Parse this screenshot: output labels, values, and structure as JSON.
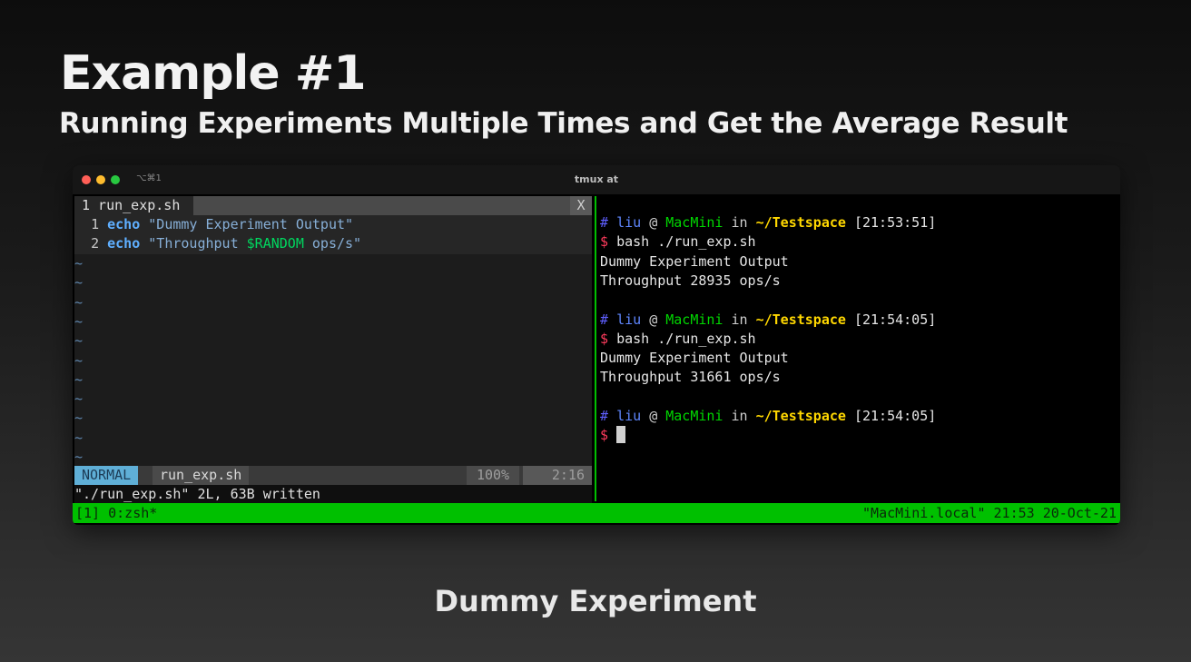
{
  "slide": {
    "title": "Example #1",
    "subtitle": "Running Experiments Multiple Times and Get the Average Result",
    "caption": "Dummy Experiment"
  },
  "window": {
    "shortcut": "⌥⌘1",
    "title": "tmux at",
    "colors": {
      "close": "#ff5f57",
      "minimize": "#febc2e",
      "zoom": "#28c840"
    }
  },
  "vim": {
    "tab_label": "1 run_exp.sh",
    "tab_close": "X",
    "lines": [
      {
        "num": "1",
        "keyword": "echo",
        "string": "\"Dummy Experiment Output\""
      },
      {
        "num": "2",
        "keyword": "echo",
        "string_before": "\"Throughput ",
        "variable": "$RANDOM",
        "string_after": " ops/s\""
      }
    ],
    "tilde": "~",
    "status": {
      "mode": "NORMAL",
      "file": "run_exp.sh",
      "percent": "100%",
      "position": "2:16"
    },
    "cmdline": "\"./run_exp.sh\" 2L, 63B written"
  },
  "shell": {
    "prompts": [
      {
        "hash": "#",
        "user": "liu",
        "at": "@",
        "host": "MacMini",
        "in": "in",
        "path": "~/Testspace",
        "time": "[21:53:51]"
      },
      {
        "hash": "#",
        "user": "liu",
        "at": "@",
        "host": "MacMini",
        "in": "in",
        "path": "~/Testspace",
        "time": "[21:54:05]"
      },
      {
        "hash": "#",
        "user": "liu",
        "at": "@",
        "host": "MacMini",
        "in": "in",
        "path": "~/Testspace",
        "time": "[21:54:05]"
      }
    ],
    "dollar": "$",
    "command": "bash ./run_exp.sh",
    "outputs": [
      {
        "line1": "Dummy Experiment Output",
        "line2": "Throughput 28935 ops/s"
      },
      {
        "line1": "Dummy Experiment Output",
        "line2": "Throughput 31661 ops/s"
      }
    ]
  },
  "tmux": {
    "left": "[1] 0:zsh*",
    "right": "\"MacMini.local\" 21:53 20-Oct-21",
    "color": "#00c000"
  }
}
